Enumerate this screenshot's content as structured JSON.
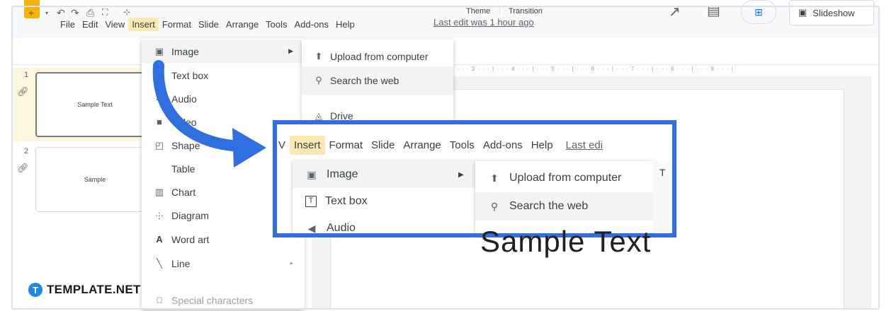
{
  "menubar": {
    "items": [
      "File",
      "Edit",
      "View",
      "Insert",
      "Format",
      "Slide",
      "Arrange",
      "Tools",
      "Add-ons",
      "Help"
    ],
    "active": "Insert",
    "last_edit": "Last edit was 1 hour ago"
  },
  "toolbar": {
    "theme_label": "Theme",
    "transition_label": "Transition"
  },
  "header": {
    "slideshow_label": "Slideshow"
  },
  "filmstrip": {
    "slides": [
      {
        "number": "1",
        "text": "Sample Text"
      },
      {
        "number": "2",
        "text": "Sample"
      }
    ]
  },
  "insert_menu": {
    "items": [
      {
        "label": "Image",
        "icon": "image-icon",
        "has_submenu": true
      },
      {
        "label": "Text box",
        "icon": "text-box-icon"
      },
      {
        "label": "Audio",
        "icon": "audio-icon"
      },
      {
        "label": "Video",
        "icon": "video-icon"
      },
      {
        "label": "Shape",
        "icon": "shape-icon"
      },
      {
        "label": "Table",
        "icon": "table-icon"
      },
      {
        "label": "Chart",
        "icon": "chart-icon"
      },
      {
        "label": "Diagram",
        "icon": "diagram-icon"
      },
      {
        "label": "Word art",
        "icon": "word-art-icon"
      },
      {
        "label": "Line",
        "icon": "line-icon",
        "has_submenu": true
      },
      {
        "label": "Special characters",
        "icon": "omega-icon"
      }
    ]
  },
  "image_submenu": {
    "items": [
      {
        "label": "Upload from computer",
        "icon": "upload-icon"
      },
      {
        "label": "Search the web",
        "icon": "search-icon"
      },
      {
        "label": "Drive",
        "icon": "drive-icon"
      }
    ]
  },
  "zoom": {
    "menubar": [
      "V",
      "Insert",
      "Format",
      "Slide",
      "Arrange",
      "Tools",
      "Add-ons",
      "Help"
    ],
    "last_edit": "Last edi",
    "dropdown": [
      "Image",
      "Text box",
      "Audio"
    ],
    "submenu": [
      "Upload from computer",
      "Search the web"
    ],
    "right_t": "T"
  },
  "canvas": {
    "text": "Sample Text"
  },
  "brand": {
    "name": "TEMPLATE.NET",
    "badge": "T"
  },
  "colors": {
    "highlight_blue": "#2f6fe0",
    "menu_active": "#fce8b2",
    "logo_yellow": "#f4b400"
  }
}
